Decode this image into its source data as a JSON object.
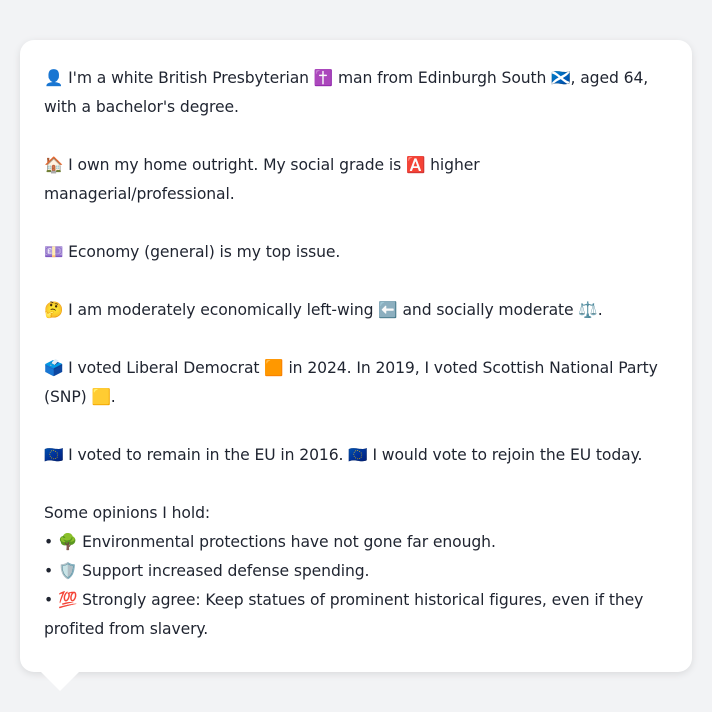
{
  "paragraphs": [
    "👤 I'm a white British Presbyterian ✝️ man from Edinburgh South 🏴󠁧󠁢󠁳󠁣󠁴󠁿, aged 64, with a bachelor's degree.",
    "🏠 I own my home outright. My social grade is 🅰️ higher managerial/professional.",
    "💷 Economy (general) is my top issue.",
    "🤔 I am moderately economically left-wing ⬅️ and socially moderate ⚖️.",
    "🗳️ I voted Liberal Democrat 🟧 in 2024. In 2019, I voted Scottish National Party (SNP) 🟨.",
    "🇪🇺 I voted to remain in the EU in 2016. 🇪🇺 I would vote to rejoin the EU today."
  ],
  "opinions": {
    "heading": "Some opinions I hold:",
    "items": [
      "• 🌳 Environmental protections have not gone far enough.",
      "• 🛡️ Support increased defense spending.",
      "• 💯 Strongly agree: Keep statues of prominent historical figures, even if they profited from slavery."
    ]
  }
}
